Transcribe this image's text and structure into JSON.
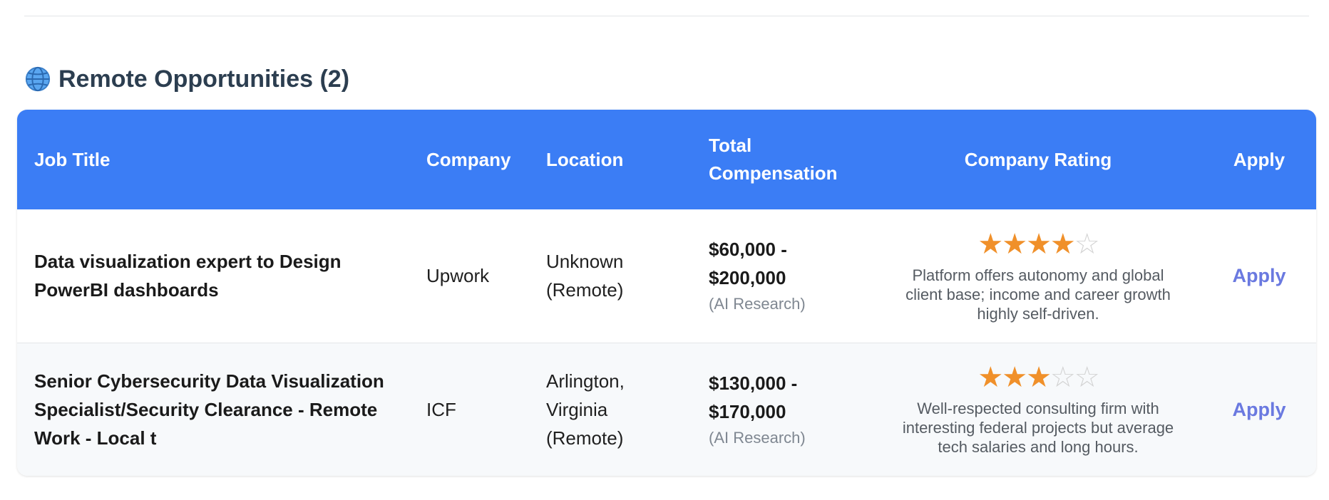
{
  "section": {
    "icon": "globe-icon",
    "title": "Remote Opportunities (2)"
  },
  "table": {
    "headers": {
      "job_title": "Job Title",
      "company": "Company",
      "location": "Location",
      "compensation": "Total Compensation",
      "rating": "Company Rating",
      "apply": "Apply"
    },
    "rows": [
      {
        "job_title": "Data visualization expert to Design PowerBI dashboards",
        "company": "Upwork",
        "location": "Unknown (Remote)",
        "compensation": "$60,000 - $200,000",
        "comp_source": "(AI Research)",
        "rating": 4,
        "rating_max": 5,
        "rating_desc": "Platform offers autonomy and global client base; income and career growth highly self-driven.",
        "apply_label": "Apply"
      },
      {
        "job_title": "Senior Cybersecurity Data Visualization Specialist/Security Clearance - Remote Work - Local t",
        "company": "ICF",
        "location": "Arlington, Virginia (Remote)",
        "compensation": "$130,000 - $170,000",
        "comp_source": "(AI Research)",
        "rating": 3,
        "rating_max": 5,
        "rating_desc": "Well-respected consulting firm with interesting federal projects but average tech salaries and long hours.",
        "apply_label": "Apply"
      }
    ]
  },
  "colors": {
    "header_bg": "#3b7df5",
    "star_full": "#f0902a",
    "star_empty": "#d3d3d3",
    "apply_link": "#6a79e0",
    "title_text": "#2c3e50"
  }
}
